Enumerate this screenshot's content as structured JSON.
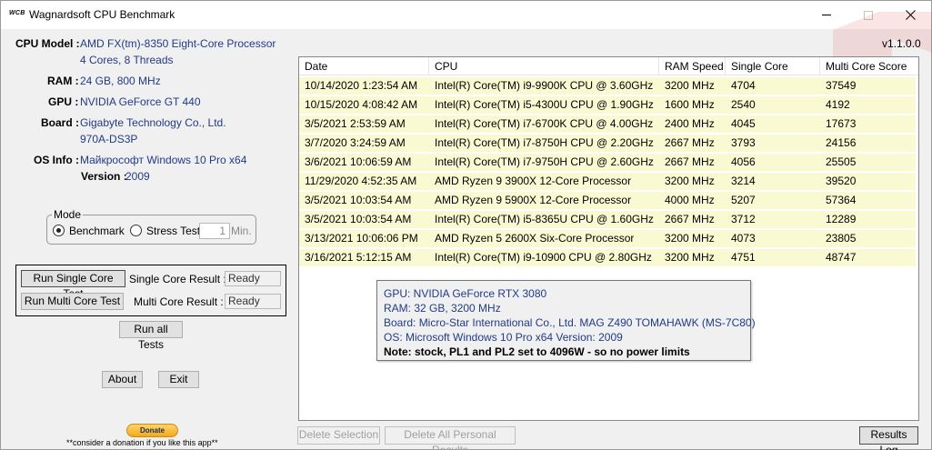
{
  "window": {
    "logo_text": "WCB",
    "title": "Wagnardsoft CPU Benchmark",
    "version": "v1.1.0.0"
  },
  "system": {
    "cpu_model_label": "CPU Model :",
    "cpu_model": "AMD FX(tm)-8350 Eight-Core Processor",
    "cpu_cores": "4 Cores, 8 Threads",
    "ram_label": "RAM :",
    "ram": "24 GB, 800 MHz",
    "gpu_label": "GPU :",
    "gpu": "NVIDIA GeForce GT 440",
    "board_label": "Board :",
    "board": "Gigabyte Technology Co., Ltd.",
    "board_model": "970A-DS3P",
    "os_label": "OS Info :",
    "os": "Майкрософт Windows 10 Pro x64",
    "os_version_label": "Version :",
    "os_version": "2009"
  },
  "mode": {
    "title": "Mode",
    "benchmark_label": "Benchmark",
    "stress_label": "Stress Test",
    "minutes_value": "1",
    "minutes_unit": "Min."
  },
  "tests": {
    "run_single_label": "Run Single Core Test",
    "single_result_label": "Single Core Result :",
    "single_result": "Ready",
    "run_multi_label": "Run Multi Core Test",
    "multi_result_label": "Multi Core Result :",
    "multi_result": "Ready",
    "run_all_label": "Run all Tests",
    "about_label": "About",
    "exit_label": "Exit",
    "donate_label": "Donate",
    "donate_note": "**consider a donation if you like this app**"
  },
  "results": {
    "columns": [
      "Date",
      "CPU",
      "RAM Speed",
      "Single Core Score",
      "Multi Core Score"
    ],
    "rows": [
      {
        "date": "10/14/2020 1:23:54 AM",
        "cpu": "Intel(R) Core(TM) i9-9900K CPU @ 3.60GHz",
        "ram": "3200 MHz",
        "single": "4704",
        "multi": "37549"
      },
      {
        "date": "10/15/2020 4:08:42 AM",
        "cpu": "Intel(R) Core(TM) i5-4300U CPU @ 1.90GHz",
        "ram": "1600 MHz",
        "single": "2540",
        "multi": "4192"
      },
      {
        "date": "3/5/2021 2:53:59 AM",
        "cpu": "Intel(R) Core(TM) i7-6700K CPU @ 4.00GHz",
        "ram": "2400 MHz",
        "single": "4045",
        "multi": "17673"
      },
      {
        "date": "3/7/2020 3:24:59 AM",
        "cpu": "Intel(R) Core(TM) i7-8750H CPU @ 2.20GHz",
        "ram": "2667 MHz",
        "single": "3793",
        "multi": "24156"
      },
      {
        "date": "3/6/2021 10:06:59 AM",
        "cpu": "Intel(R) Core(TM) i7-9750H CPU @ 2.60GHz",
        "ram": "2667 MHz",
        "single": "4056",
        "multi": "25505"
      },
      {
        "date": "11/29/2020 4:52:35 AM",
        "cpu": "AMD Ryzen 9 3900X 12-Core Processor",
        "ram": "3200 MHz",
        "single": "3214",
        "multi": "39520"
      },
      {
        "date": "3/5/2021 10:03:54 AM",
        "cpu": "AMD Ryzen 9 5900X 12-Core Processor",
        "ram": "4000 MHz",
        "single": "5207",
        "multi": "57364"
      },
      {
        "date": "3/5/2021 10:03:54 AM",
        "cpu": "Intel(R) Core(TM) i5-8365U CPU @ 1.60GHz",
        "ram": "2667 MHz",
        "single": "3712",
        "multi": "12289"
      },
      {
        "date": "3/13/2021 10:06:06 PM",
        "cpu": "AMD Ryzen 5 2600X Six-Core Processor",
        "ram": "3200 MHz",
        "single": "4073",
        "multi": "23805"
      },
      {
        "date": "3/16/2021 5:12:15 AM",
        "cpu": "Intel(R) Core(TM) i9-10900 CPU @ 2.80GHz",
        "ram": "3200 MHz",
        "single": "4751",
        "multi": "48747"
      }
    ],
    "delete_selection_label": "Delete Selection",
    "delete_all_label": "Delete All Personal Results",
    "results_log_label": "Results Log"
  },
  "tooltip": {
    "gpu": "GPU: NVIDIA GeForce RTX 3080",
    "ram": "RAM: 32 GB, 3200 MHz",
    "board": "Board: Micro-Star International Co., Ltd. MAG Z490 TOMAHAWK (MS-7C80)",
    "os": "OS: Microsoft Windows 10 Pro x64 Version: 2009",
    "note": "Note: stock, PL1 and PL2 set to 4096W - so no power limits"
  },
  "colors": {
    "value_text": "#1f3b8c",
    "row_highlight": "#fafad2",
    "decor_red": "#e03030"
  }
}
